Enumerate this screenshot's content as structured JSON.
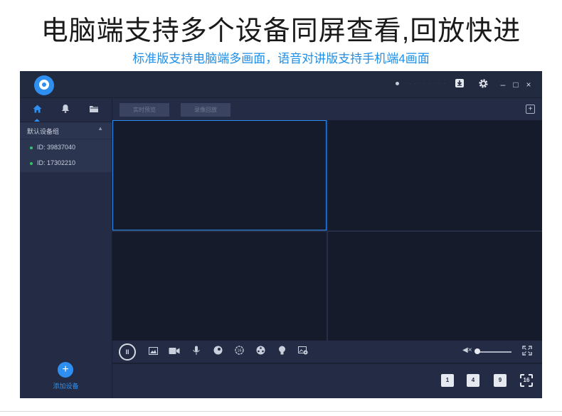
{
  "promo": {
    "headline": "电脑端支持多个设备同屏查看,回放快进",
    "subline": "标准版支持电脑端多画面，语音对讲版支持手机端4画面"
  },
  "titlebar": {
    "user_name": "· · · · · · · · ·",
    "icons": [
      "download-icon",
      "gear-icon"
    ],
    "window_controls": [
      "–",
      "□",
      "×"
    ]
  },
  "sidebar": {
    "tabs": [
      "home-icon",
      "bell-icon",
      "folder-icon"
    ],
    "active_tab": "home-icon",
    "group_label": "默认设备组",
    "devices": [
      {
        "label": "ID: 39837040",
        "status": "online"
      },
      {
        "label": "ID: 17302210",
        "status": "online"
      }
    ],
    "add_label": "添加设备"
  },
  "content": {
    "tabs": [
      {
        "label": "实时预览"
      },
      {
        "label": "录像回放"
      }
    ],
    "selected_pane": 1,
    "pane_count": 4
  },
  "controls": {
    "pause_glyph": "II",
    "icons": [
      "image-icon",
      "video-camera-icon",
      "microphone-icon",
      "ptz-ball-icon",
      "speed-icon",
      "focus-icon",
      "light-bulb-icon",
      "image-settings-icon"
    ],
    "volume_level": 0,
    "volume_glyph": "◀×"
  },
  "layouts": [
    "1",
    "4",
    "9",
    "16"
  ],
  "colors": {
    "accent": "#2e8ff0",
    "app_bg": "#232c44",
    "pane_bg": "#161b2b",
    "online": "#35c26a"
  }
}
